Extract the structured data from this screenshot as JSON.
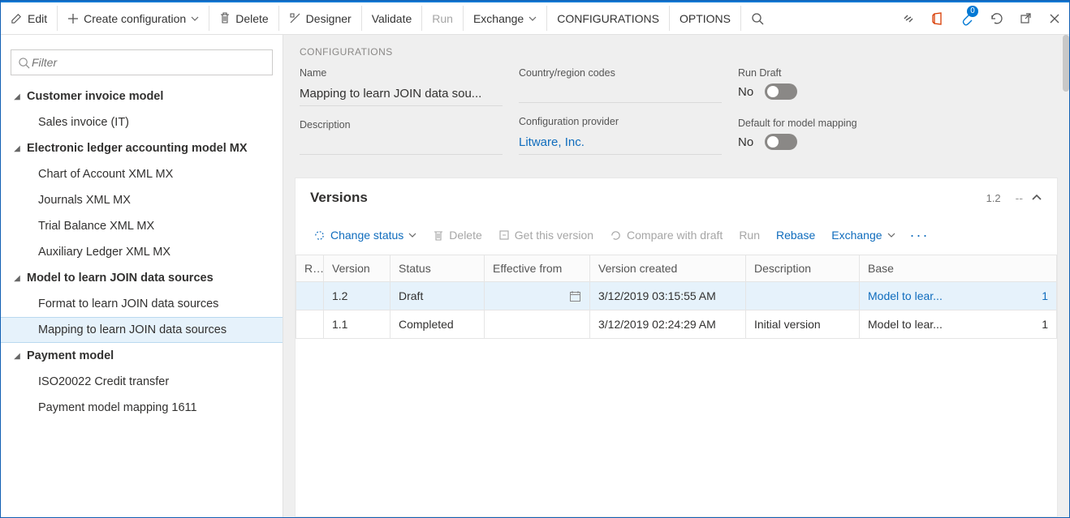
{
  "toolbar": {
    "edit": "Edit",
    "create": "Create configuration",
    "delete": "Delete",
    "designer": "Designer",
    "validate": "Validate",
    "run": "Run",
    "exchange": "Exchange",
    "configurations": "CONFIGURATIONS",
    "options": "OPTIONS",
    "attach_badge": "0"
  },
  "filter": {
    "placeholder": "Filter"
  },
  "tree": {
    "g1": "Customer invoice model",
    "g1_c1": "Sales invoice (IT)",
    "g2": "Electronic ledger accounting model MX",
    "g2_c1": "Chart of Account XML MX",
    "g2_c2": "Journals XML MX",
    "g2_c3": "Trial Balance XML MX",
    "g2_c4": "Auxiliary Ledger XML MX",
    "g3": "Model to learn JOIN data sources",
    "g3_c1": "Format to learn JOIN data sources",
    "g3_c2": "Mapping to learn JOIN data sources",
    "g4": "Payment model",
    "g4_c1": "ISO20022 Credit transfer",
    "g4_c2": "Payment model mapping 1611"
  },
  "config": {
    "section": "CONFIGURATIONS",
    "name_label": "Name",
    "name_value": "Mapping to learn JOIN data sou...",
    "desc_label": "Description",
    "desc_value": "",
    "country_label": "Country/region codes",
    "provider_label": "Configuration provider",
    "provider_value": "Litware, Inc.",
    "rundraft_label": "Run Draft",
    "rundraft_value": "No",
    "defaultmap_label": "Default for model mapping",
    "defaultmap_value": "No"
  },
  "versions": {
    "title": "Versions",
    "badge": "1.2",
    "dash": "--",
    "tb_change": "Change status",
    "tb_delete": "Delete",
    "tb_get": "Get this version",
    "tb_compare": "Compare with draft",
    "tb_run": "Run",
    "tb_rebase": "Rebase",
    "tb_exchange": "Exchange",
    "cols": {
      "r": "R...",
      "version": "Version",
      "status": "Status",
      "eff": "Effective from",
      "created": "Version created",
      "desc": "Description",
      "base": "Base"
    },
    "rows": [
      {
        "r": "",
        "version": "1.2",
        "status": "Draft",
        "eff_icon": true,
        "created": "3/12/2019 03:15:55 AM",
        "desc": "",
        "base": "Model to lear...",
        "basev": "1",
        "selected": true
      },
      {
        "r": "",
        "version": "1.1",
        "status": "Completed",
        "eff_icon": false,
        "created": "3/12/2019 02:24:29 AM",
        "desc": "Initial version",
        "base": "Model to lear...",
        "basev": "1",
        "selected": false
      }
    ]
  }
}
